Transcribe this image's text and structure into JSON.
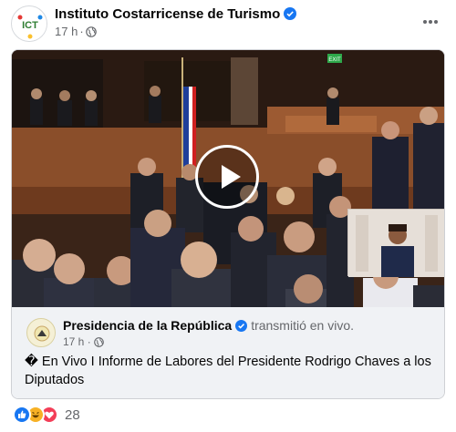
{
  "post": {
    "page_name": "Instituto Costarricense de Turismo",
    "time": "17 h",
    "separator": "·",
    "avatar_text": "ICT"
  },
  "shared": {
    "source_name": "Presidencia de la República",
    "action": "transmitió en vivo.",
    "time": "17 h",
    "separator": "·",
    "text": "� En Vivo I Informe de Labores del Presidente Rodrigo Chaves a los Diputados"
  },
  "video": {
    "exit_sign": "EXIT"
  },
  "reactions": {
    "count": "28",
    "types": [
      "like-icon",
      "haha-icon",
      "love-icon"
    ]
  },
  "colors": {
    "accent": "#1877f2",
    "muted_text": "#65676b",
    "share_bg": "#f0f2f5"
  }
}
